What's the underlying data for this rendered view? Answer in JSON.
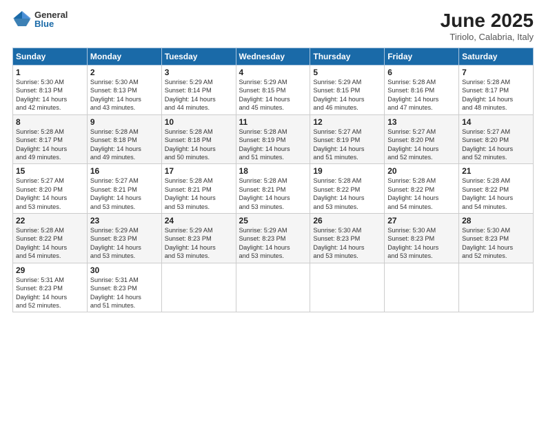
{
  "logo": {
    "general": "General",
    "blue": "Blue"
  },
  "title": "June 2025",
  "subtitle": "Tiriolo, Calabria, Italy",
  "headers": [
    "Sunday",
    "Monday",
    "Tuesday",
    "Wednesday",
    "Thursday",
    "Friday",
    "Saturday"
  ],
  "weeks": [
    [
      {
        "num": "1",
        "info": "Sunrise: 5:30 AM\nSunset: 8:13 PM\nDaylight: 14 hours\nand 42 minutes."
      },
      {
        "num": "2",
        "info": "Sunrise: 5:30 AM\nSunset: 8:13 PM\nDaylight: 14 hours\nand 43 minutes."
      },
      {
        "num": "3",
        "info": "Sunrise: 5:29 AM\nSunset: 8:14 PM\nDaylight: 14 hours\nand 44 minutes."
      },
      {
        "num": "4",
        "info": "Sunrise: 5:29 AM\nSunset: 8:15 PM\nDaylight: 14 hours\nand 45 minutes."
      },
      {
        "num": "5",
        "info": "Sunrise: 5:29 AM\nSunset: 8:15 PM\nDaylight: 14 hours\nand 46 minutes."
      },
      {
        "num": "6",
        "info": "Sunrise: 5:28 AM\nSunset: 8:16 PM\nDaylight: 14 hours\nand 47 minutes."
      },
      {
        "num": "7",
        "info": "Sunrise: 5:28 AM\nSunset: 8:17 PM\nDaylight: 14 hours\nand 48 minutes."
      }
    ],
    [
      {
        "num": "8",
        "info": "Sunrise: 5:28 AM\nSunset: 8:17 PM\nDaylight: 14 hours\nand 49 minutes."
      },
      {
        "num": "9",
        "info": "Sunrise: 5:28 AM\nSunset: 8:18 PM\nDaylight: 14 hours\nand 49 minutes."
      },
      {
        "num": "10",
        "info": "Sunrise: 5:28 AM\nSunset: 8:18 PM\nDaylight: 14 hours\nand 50 minutes."
      },
      {
        "num": "11",
        "info": "Sunrise: 5:28 AM\nSunset: 8:19 PM\nDaylight: 14 hours\nand 51 minutes."
      },
      {
        "num": "12",
        "info": "Sunrise: 5:27 AM\nSunset: 8:19 PM\nDaylight: 14 hours\nand 51 minutes."
      },
      {
        "num": "13",
        "info": "Sunrise: 5:27 AM\nSunset: 8:20 PM\nDaylight: 14 hours\nand 52 minutes."
      },
      {
        "num": "14",
        "info": "Sunrise: 5:27 AM\nSunset: 8:20 PM\nDaylight: 14 hours\nand 52 minutes."
      }
    ],
    [
      {
        "num": "15",
        "info": "Sunrise: 5:27 AM\nSunset: 8:20 PM\nDaylight: 14 hours\nand 53 minutes."
      },
      {
        "num": "16",
        "info": "Sunrise: 5:27 AM\nSunset: 8:21 PM\nDaylight: 14 hours\nand 53 minutes."
      },
      {
        "num": "17",
        "info": "Sunrise: 5:28 AM\nSunset: 8:21 PM\nDaylight: 14 hours\nand 53 minutes."
      },
      {
        "num": "18",
        "info": "Sunrise: 5:28 AM\nSunset: 8:21 PM\nDaylight: 14 hours\nand 53 minutes."
      },
      {
        "num": "19",
        "info": "Sunrise: 5:28 AM\nSunset: 8:22 PM\nDaylight: 14 hours\nand 53 minutes."
      },
      {
        "num": "20",
        "info": "Sunrise: 5:28 AM\nSunset: 8:22 PM\nDaylight: 14 hours\nand 54 minutes."
      },
      {
        "num": "21",
        "info": "Sunrise: 5:28 AM\nSunset: 8:22 PM\nDaylight: 14 hours\nand 54 minutes."
      }
    ],
    [
      {
        "num": "22",
        "info": "Sunrise: 5:28 AM\nSunset: 8:22 PM\nDaylight: 14 hours\nand 54 minutes."
      },
      {
        "num": "23",
        "info": "Sunrise: 5:29 AM\nSunset: 8:23 PM\nDaylight: 14 hours\nand 53 minutes."
      },
      {
        "num": "24",
        "info": "Sunrise: 5:29 AM\nSunset: 8:23 PM\nDaylight: 14 hours\nand 53 minutes."
      },
      {
        "num": "25",
        "info": "Sunrise: 5:29 AM\nSunset: 8:23 PM\nDaylight: 14 hours\nand 53 minutes."
      },
      {
        "num": "26",
        "info": "Sunrise: 5:30 AM\nSunset: 8:23 PM\nDaylight: 14 hours\nand 53 minutes."
      },
      {
        "num": "27",
        "info": "Sunrise: 5:30 AM\nSunset: 8:23 PM\nDaylight: 14 hours\nand 53 minutes."
      },
      {
        "num": "28",
        "info": "Sunrise: 5:30 AM\nSunset: 8:23 PM\nDaylight: 14 hours\nand 52 minutes."
      }
    ],
    [
      {
        "num": "29",
        "info": "Sunrise: 5:31 AM\nSunset: 8:23 PM\nDaylight: 14 hours\nand 52 minutes."
      },
      {
        "num": "30",
        "info": "Sunrise: 5:31 AM\nSunset: 8:23 PM\nDaylight: 14 hours\nand 51 minutes."
      },
      {
        "num": "",
        "info": ""
      },
      {
        "num": "",
        "info": ""
      },
      {
        "num": "",
        "info": ""
      },
      {
        "num": "",
        "info": ""
      },
      {
        "num": "",
        "info": ""
      }
    ]
  ]
}
